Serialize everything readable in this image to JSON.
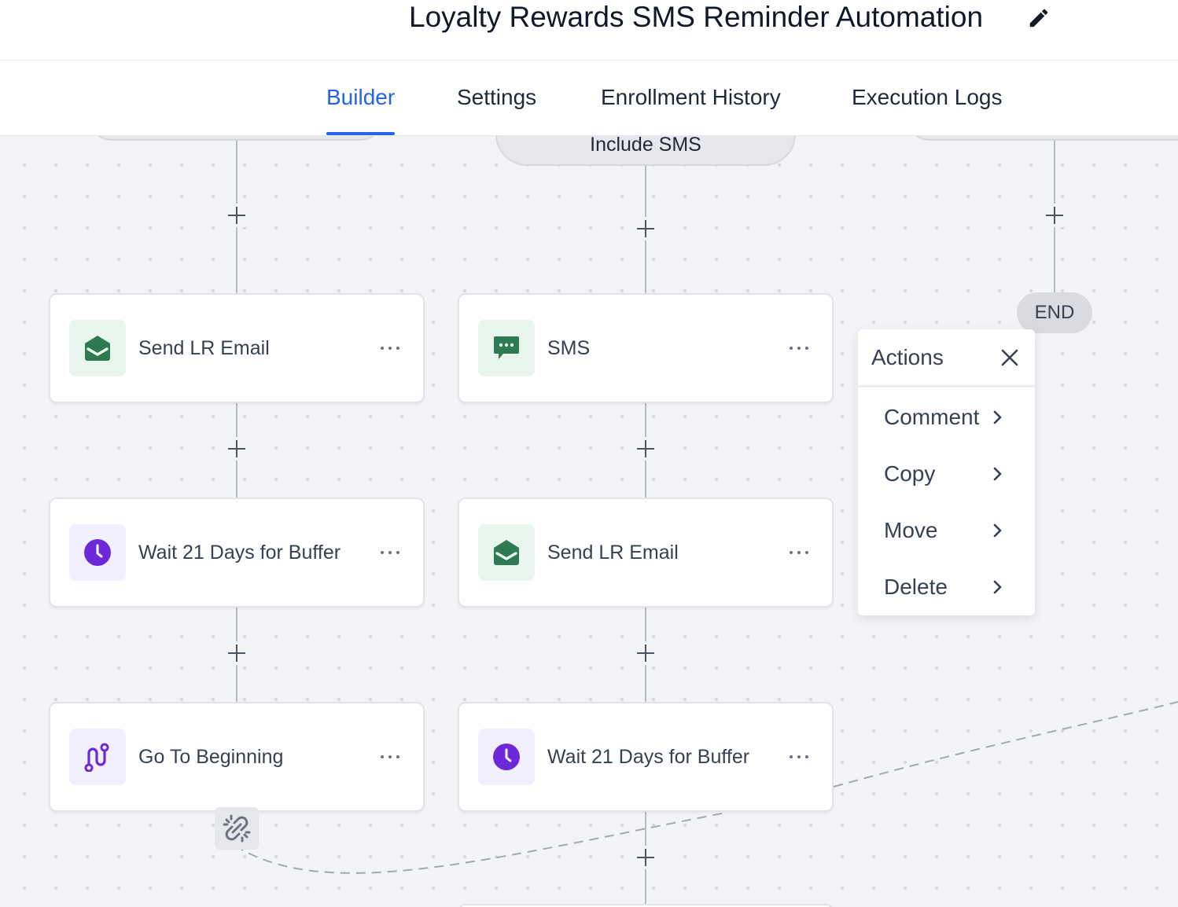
{
  "header": {
    "title": "Loyalty Rewards SMS Reminder Automation",
    "edit_icon": "pencil-icon"
  },
  "tabs": [
    {
      "label": "Builder",
      "active": true
    },
    {
      "label": "Settings",
      "active": false
    },
    {
      "label": "Enrollment History",
      "active": false
    },
    {
      "label": "Execution Logs",
      "active": false
    }
  ],
  "canvas": {
    "branch_label": "Include SMS",
    "end_label": "END",
    "link_icon": "unlink-icon",
    "nodes": [
      {
        "label": "Send LR Email",
        "icon": "email-open-icon"
      },
      {
        "label": "SMS",
        "icon": "sms-chat-icon"
      },
      {
        "label": "Wait 21 Days for Buffer",
        "icon": "clock-icon"
      },
      {
        "label": "Send LR Email",
        "icon": "email-open-icon"
      },
      {
        "label": "Go To Beginning",
        "icon": "goto-route-icon"
      },
      {
        "label": "Wait 21 Days for Buffer",
        "icon": "clock-icon"
      }
    ]
  },
  "actions_menu": {
    "title": "Actions",
    "close_icon": "close-icon",
    "items": [
      {
        "label": "Comment",
        "icon": "chevron-right-icon"
      },
      {
        "label": "Copy",
        "icon": "chevron-right-icon"
      },
      {
        "label": "Move",
        "icon": "chevron-right-icon"
      },
      {
        "label": "Delete",
        "icon": "chevron-right-icon"
      }
    ]
  },
  "colors": {
    "accent": "#2563eb",
    "email_green": "#2f7a52",
    "wait_purple": "#6d28d9",
    "canvas_bg": "#f3f4f7"
  }
}
